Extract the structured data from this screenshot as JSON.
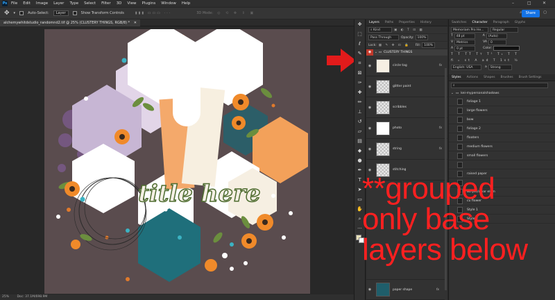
{
  "menubar": {
    "logo": "Ps",
    "items": [
      "File",
      "Edit",
      "Image",
      "Layer",
      "Type",
      "Select",
      "Filter",
      "3D",
      "View",
      "Plugins",
      "Window",
      "Help"
    ],
    "window_controls": [
      "–",
      "□",
      "✕"
    ]
  },
  "options": {
    "auto_select_label": "Auto-Select:",
    "auto_select_value": "Layer",
    "show_transform": "Show Transform Controls",
    "mode_3d": "3D Mode:",
    "share_label": "Share"
  },
  "document": {
    "tab_title": "alchemywhitdstudio_randomnd2.tif @ 25% (CLUSTERY THINGS, RGB/8) *",
    "zoom": "25%",
    "doc_info": "Doc: 37.1M/698.9M",
    "title_art_text": "title here"
  },
  "layers": {
    "tabs": [
      "Layers",
      "Paths",
      "Properties",
      "History"
    ],
    "kind_label": "Kind",
    "blend_mode": "Pass Through",
    "opacity_label": "Opacity:",
    "opacity_value": "100%",
    "lock_label": "Lock:",
    "fill_label": "Fill:",
    "fill_value": "100%",
    "group_name": "CLUSTERY THINGS",
    "fx_symbol": "fx",
    "items": [
      {
        "name": "circle tag"
      },
      {
        "name": "glitter paint"
      },
      {
        "name": "scribbles"
      },
      {
        "name": "photo"
      },
      {
        "name": "string"
      },
      {
        "name": "stitching"
      },
      {
        "name": "paper shape"
      }
    ]
  },
  "character": {
    "tabs": [
      "Swatches",
      "Character",
      "Paragraph",
      "Glyphs"
    ],
    "font_family": "Memoriam Pro He...",
    "font_style": "Regular",
    "font_size": "48 pt",
    "leading": "(Auto)",
    "kerning": "Metrics",
    "tracking": "0",
    "scale_v": "0 pt",
    "color_label": "Color:",
    "language": "English: USA",
    "antialias": "Strong"
  },
  "styles": {
    "tabs": [
      "Styles",
      "Actions",
      "Shapes",
      "Brushes",
      "Brush Settings"
    ],
    "folder": "kei-mypersonalshadows",
    "items": [
      "foliage 1",
      "large flowers",
      "bow",
      "foliage 2",
      "floaters",
      "medium flowers",
      "small flowers",
      "",
      "raised paper",
      "",
      "acrylic/clear elem",
      "cu flower",
      "Style 1",
      "Style 2"
    ]
  },
  "annotation": {
    "lines": [
      "**grouped",
      "only base",
      "layers below"
    ],
    "color": "#ff2020"
  }
}
